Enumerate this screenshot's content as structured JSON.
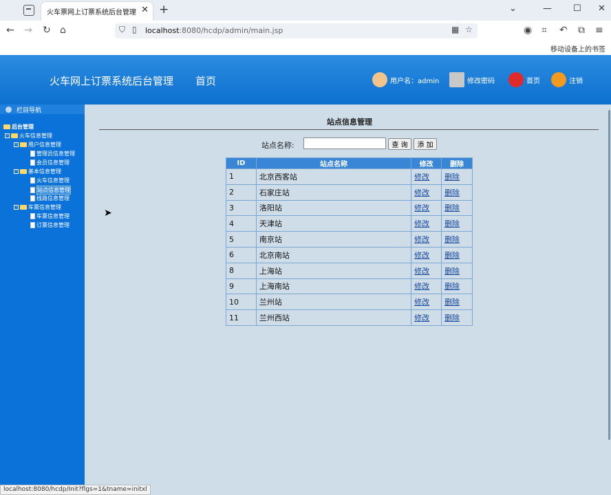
{
  "browser": {
    "tab_title": "火车票网上订票系统后台管理",
    "close_glyph": "✕",
    "new_tab_glyph": "+",
    "url_host": "localhost",
    "url_rest": ":8080/hcdp/admin/main.jsp",
    "mobile_bookmark": "移动设备上的书签",
    "status_url": "localhost:8080/hcdp/Init?flgs=1&tname=initxl"
  },
  "header": {
    "title": "火车网上订票系统后台管理",
    "home_nav": "首页",
    "user_label": "用户名：admin",
    "change_password": "修改密码",
    "home": "首页",
    "logout": "注销"
  },
  "sidebar": {
    "heading": "栏目导航",
    "root": "后台管理",
    "groups": [
      {
        "label": "火车信息管理"
      },
      {
        "label": "用户信息管理",
        "items": [
          "管理员信息管理",
          "会员信息管理"
        ]
      },
      {
        "label": "基本信息管理",
        "items": [
          "火车信息管理",
          "站点信息管理",
          "线路信息管理"
        ]
      },
      {
        "label": "车票信息管理",
        "items": [
          "车票信息管理",
          "订票信息管理"
        ]
      }
    ]
  },
  "content": {
    "title": "站点信息管理",
    "search_label": "站点名称:",
    "query_button": "查 询",
    "add_button": "添 加",
    "columns": [
      "ID",
      "站点名称",
      "修改",
      "删除"
    ],
    "edit_link": "修改",
    "delete_link": "删除",
    "rows": [
      {
        "id": "1",
        "name": "北京西客站"
      },
      {
        "id": "2",
        "name": "石家庄站"
      },
      {
        "id": "3",
        "name": "洛阳站"
      },
      {
        "id": "4",
        "name": "天津站"
      },
      {
        "id": "5",
        "name": "南京站"
      },
      {
        "id": "6",
        "name": "北京南站"
      },
      {
        "id": "8",
        "name": "上海站"
      },
      {
        "id": "9",
        "name": "上海南站"
      },
      {
        "id": "10",
        "name": "兰州站"
      },
      {
        "id": "11",
        "name": "兰州西站"
      }
    ]
  },
  "colors": {
    "header_blue": "#0d6fcf",
    "sidebar_blue": "#0a72d8",
    "content_bg": "#cfdde8"
  }
}
